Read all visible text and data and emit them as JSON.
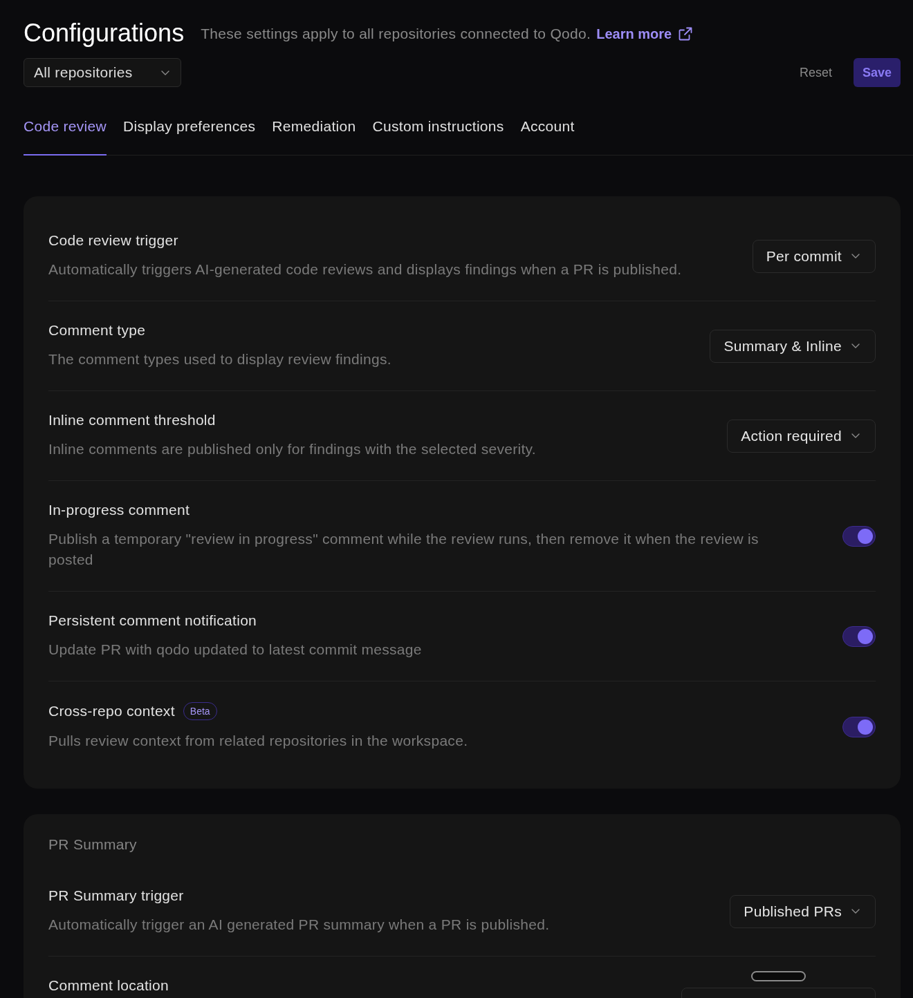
{
  "header": {
    "title": "Configurations",
    "subtitle": "These settings apply to all repositories connected to Qodo.",
    "link": "Learn more"
  },
  "repository_select": {
    "value": "All repositories"
  },
  "actions": [
    {
      "label": "Reset",
      "kind": "secondary"
    },
    {
      "label": "Save",
      "kind": "primary"
    }
  ],
  "tabs": [
    {
      "label": "Code review",
      "selected": true
    },
    {
      "label": "Display preferences",
      "selected": false
    },
    {
      "label": "Remediation",
      "selected": false
    },
    {
      "label": "Custom instructions",
      "selected": false
    },
    {
      "label": "Account",
      "selected": false
    }
  ],
  "sections": [
    {
      "settings": [
        {
          "kind": "select",
          "title": "Code review trigger",
          "description": "Automatically triggers AI-generated code reviews and displays findings when a PR is published.",
          "value": "Per commit"
        },
        {
          "kind": "select",
          "title": "Comment type",
          "description": "The comment types used to display review findings.",
          "value": "Summary & Inline"
        },
        {
          "kind": "select",
          "title": "Inline comment threshold",
          "description": "Inline comments are published only for findings with the selected severity.",
          "value": "Action required"
        },
        {
          "kind": "toggle",
          "title": "In-progress comment",
          "description": "Publish a temporary \"review in progress\" comment while the review runs, then remove it when the review is posted",
          "on": true
        },
        {
          "kind": "toggle",
          "title": "Persistent comment notification",
          "description": "Update PR with qodo updated to latest commit message",
          "on": true
        },
        {
          "kind": "toggle",
          "title": "Cross-repo context",
          "badge": "Beta",
          "description": "Pulls review context from related repositories in the workspace.",
          "on": true
        }
      ]
    },
    {
      "heading": "PR Summary",
      "settings": [
        {
          "kind": "select",
          "title": "PR Summary trigger",
          "description": "Automatically trigger an AI generated PR summary when a PR is published.",
          "value": "Published PRs"
        },
        {
          "kind": "stacked_select",
          "title": "Comment location"
        }
      ]
    }
  ]
}
